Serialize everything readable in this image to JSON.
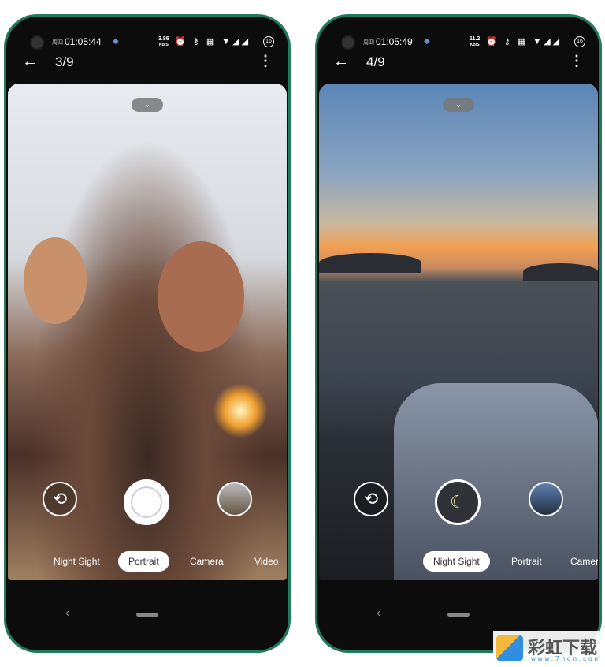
{
  "phones": [
    {
      "weekday": "周四",
      "time": "01:05:44",
      "net_speed": "3.86",
      "net_unit": "KB/S",
      "battery": "16",
      "counter": "3/9",
      "modes": [
        "Night Sight",
        "Portrait",
        "Camera",
        "Video"
      ],
      "selected_mode": "Portrait"
    },
    {
      "weekday": "周四",
      "time": "01:05:49",
      "net_speed": "11.2",
      "net_unit": "KB/S",
      "battery": "16",
      "counter": "4/9",
      "modes": [
        "Night Sight",
        "Portrait",
        "Camera"
      ],
      "selected_mode": "Night Sight"
    }
  ],
  "icons": {
    "back": "arrow-left-icon",
    "more": "more-vert-icon",
    "collapse": "chevron-down-icon",
    "switch": "camera-switch-icon",
    "night": "moon-icon"
  },
  "accent": "#1f7a5e",
  "watermark": {
    "name": "彩虹下载",
    "url": "www.7hon.com"
  }
}
